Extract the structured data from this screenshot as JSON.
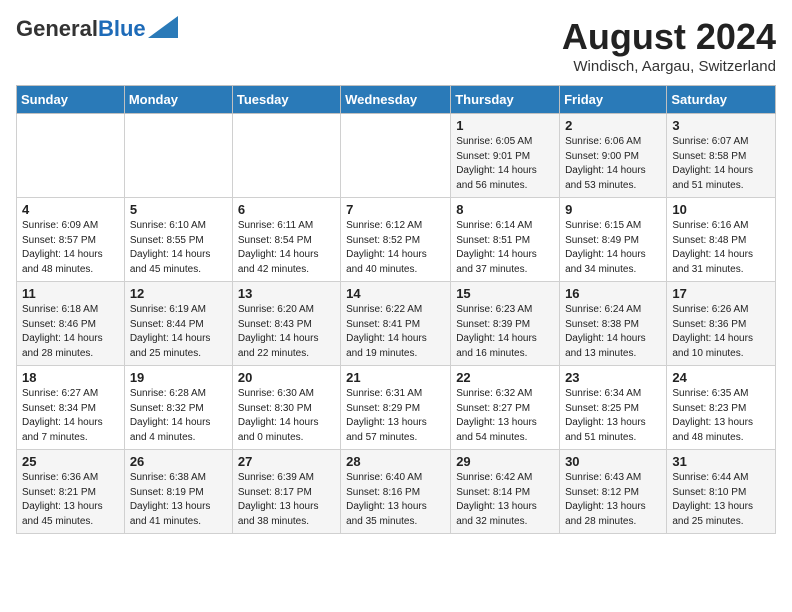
{
  "header": {
    "logo": {
      "general": "General",
      "blue": "Blue"
    },
    "title": "August 2024",
    "location": "Windisch, Aargau, Switzerland"
  },
  "weekdays": [
    "Sunday",
    "Monday",
    "Tuesday",
    "Wednesday",
    "Thursday",
    "Friday",
    "Saturday"
  ],
  "weeks": [
    [
      {
        "day": "",
        "info": ""
      },
      {
        "day": "",
        "info": ""
      },
      {
        "day": "",
        "info": ""
      },
      {
        "day": "",
        "info": ""
      },
      {
        "day": "1",
        "info": "Sunrise: 6:05 AM\nSunset: 9:01 PM\nDaylight: 14 hours\nand 56 minutes."
      },
      {
        "day": "2",
        "info": "Sunrise: 6:06 AM\nSunset: 9:00 PM\nDaylight: 14 hours\nand 53 minutes."
      },
      {
        "day": "3",
        "info": "Sunrise: 6:07 AM\nSunset: 8:58 PM\nDaylight: 14 hours\nand 51 minutes."
      }
    ],
    [
      {
        "day": "4",
        "info": "Sunrise: 6:09 AM\nSunset: 8:57 PM\nDaylight: 14 hours\nand 48 minutes."
      },
      {
        "day": "5",
        "info": "Sunrise: 6:10 AM\nSunset: 8:55 PM\nDaylight: 14 hours\nand 45 minutes."
      },
      {
        "day": "6",
        "info": "Sunrise: 6:11 AM\nSunset: 8:54 PM\nDaylight: 14 hours\nand 42 minutes."
      },
      {
        "day": "7",
        "info": "Sunrise: 6:12 AM\nSunset: 8:52 PM\nDaylight: 14 hours\nand 40 minutes."
      },
      {
        "day": "8",
        "info": "Sunrise: 6:14 AM\nSunset: 8:51 PM\nDaylight: 14 hours\nand 37 minutes."
      },
      {
        "day": "9",
        "info": "Sunrise: 6:15 AM\nSunset: 8:49 PM\nDaylight: 14 hours\nand 34 minutes."
      },
      {
        "day": "10",
        "info": "Sunrise: 6:16 AM\nSunset: 8:48 PM\nDaylight: 14 hours\nand 31 minutes."
      }
    ],
    [
      {
        "day": "11",
        "info": "Sunrise: 6:18 AM\nSunset: 8:46 PM\nDaylight: 14 hours\nand 28 minutes."
      },
      {
        "day": "12",
        "info": "Sunrise: 6:19 AM\nSunset: 8:44 PM\nDaylight: 14 hours\nand 25 minutes."
      },
      {
        "day": "13",
        "info": "Sunrise: 6:20 AM\nSunset: 8:43 PM\nDaylight: 14 hours\nand 22 minutes."
      },
      {
        "day": "14",
        "info": "Sunrise: 6:22 AM\nSunset: 8:41 PM\nDaylight: 14 hours\nand 19 minutes."
      },
      {
        "day": "15",
        "info": "Sunrise: 6:23 AM\nSunset: 8:39 PM\nDaylight: 14 hours\nand 16 minutes."
      },
      {
        "day": "16",
        "info": "Sunrise: 6:24 AM\nSunset: 8:38 PM\nDaylight: 14 hours\nand 13 minutes."
      },
      {
        "day": "17",
        "info": "Sunrise: 6:26 AM\nSunset: 8:36 PM\nDaylight: 14 hours\nand 10 minutes."
      }
    ],
    [
      {
        "day": "18",
        "info": "Sunrise: 6:27 AM\nSunset: 8:34 PM\nDaylight: 14 hours\nand 7 minutes."
      },
      {
        "day": "19",
        "info": "Sunrise: 6:28 AM\nSunset: 8:32 PM\nDaylight: 14 hours\nand 4 minutes."
      },
      {
        "day": "20",
        "info": "Sunrise: 6:30 AM\nSunset: 8:30 PM\nDaylight: 14 hours\nand 0 minutes."
      },
      {
        "day": "21",
        "info": "Sunrise: 6:31 AM\nSunset: 8:29 PM\nDaylight: 13 hours\nand 57 minutes."
      },
      {
        "day": "22",
        "info": "Sunrise: 6:32 AM\nSunset: 8:27 PM\nDaylight: 13 hours\nand 54 minutes."
      },
      {
        "day": "23",
        "info": "Sunrise: 6:34 AM\nSunset: 8:25 PM\nDaylight: 13 hours\nand 51 minutes."
      },
      {
        "day": "24",
        "info": "Sunrise: 6:35 AM\nSunset: 8:23 PM\nDaylight: 13 hours\nand 48 minutes."
      }
    ],
    [
      {
        "day": "25",
        "info": "Sunrise: 6:36 AM\nSunset: 8:21 PM\nDaylight: 13 hours\nand 45 minutes."
      },
      {
        "day": "26",
        "info": "Sunrise: 6:38 AM\nSunset: 8:19 PM\nDaylight: 13 hours\nand 41 minutes."
      },
      {
        "day": "27",
        "info": "Sunrise: 6:39 AM\nSunset: 8:17 PM\nDaylight: 13 hours\nand 38 minutes."
      },
      {
        "day": "28",
        "info": "Sunrise: 6:40 AM\nSunset: 8:16 PM\nDaylight: 13 hours\nand 35 minutes."
      },
      {
        "day": "29",
        "info": "Sunrise: 6:42 AM\nSunset: 8:14 PM\nDaylight: 13 hours\nand 32 minutes."
      },
      {
        "day": "30",
        "info": "Sunrise: 6:43 AM\nSunset: 8:12 PM\nDaylight: 13 hours\nand 28 minutes."
      },
      {
        "day": "31",
        "info": "Sunrise: 6:44 AM\nSunset: 8:10 PM\nDaylight: 13 hours\nand 25 minutes."
      }
    ]
  ]
}
